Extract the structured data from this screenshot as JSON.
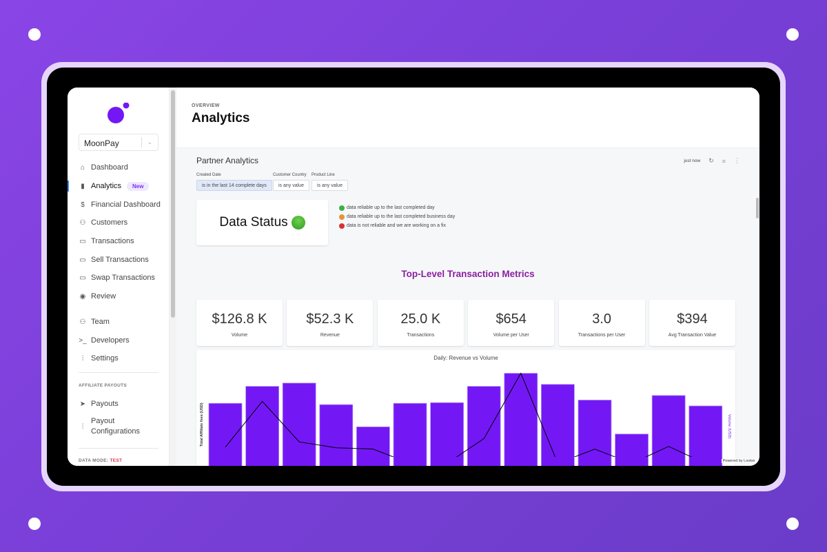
{
  "colors": {
    "accent": "#7318f5",
    "heading": "#8a1f9f",
    "test": "#e0344a",
    "line": "#000000"
  },
  "org_selector": {
    "value": "MoonPay"
  },
  "sidebar": {
    "items": [
      {
        "label": "Dashboard",
        "icon": "home-icon"
      },
      {
        "label": "Analytics",
        "icon": "bar-chart-icon",
        "badge": "New",
        "active": true
      },
      {
        "label": "Financial Dashboard",
        "icon": "dollar-icon"
      },
      {
        "label": "Customers",
        "icon": "user-check-icon"
      },
      {
        "label": "Transactions",
        "icon": "card-icon"
      },
      {
        "label": "Sell Transactions",
        "icon": "card-icon"
      },
      {
        "label": "Swap Transactions",
        "icon": "card-icon"
      },
      {
        "label": "Review",
        "icon": "eye-icon"
      },
      {
        "label": "Team",
        "icon": "users-icon"
      },
      {
        "label": "Developers",
        "icon": "terminal-icon"
      },
      {
        "label": "Settings",
        "icon": "sliders-icon"
      }
    ],
    "affiliate_section": "AFFILIATE PAYOUTS",
    "affiliate_items": [
      {
        "label": "Payouts",
        "icon": "send-icon"
      },
      {
        "label": "Payout Configurations",
        "icon": "sliders-icon"
      }
    ],
    "data_mode_label": "DATA MODE:",
    "data_mode_value": "TEST"
  },
  "header": {
    "eyebrow": "OVERVIEW",
    "title": "Analytics"
  },
  "dashboard": {
    "title": "Partner Analytics",
    "updated": "just now",
    "filters": [
      {
        "label": "Created Date",
        "value": "is in the last 14 complete days"
      },
      {
        "label": "Customer Country",
        "value": "is any value"
      },
      {
        "label": "Product Line",
        "value": "is any value"
      }
    ],
    "data_status": "Data Status",
    "legend": [
      {
        "color": "#3cb043",
        "text": "data reliable up to the last completed day"
      },
      {
        "color": "#e8923a",
        "text": "data reliable up to the last completed business day"
      },
      {
        "color": "#d93030",
        "text": "data is not reliable and we are working on a fix"
      }
    ],
    "section_title": "Top-Level Transaction Metrics",
    "kpis": [
      {
        "value": "$126.8 K",
        "label": "Volume"
      },
      {
        "value": "$52.3 K",
        "label": "Revenue"
      },
      {
        "value": "25.0 K",
        "label": "Transactions"
      },
      {
        "value": "$654",
        "label": "Volume per User"
      },
      {
        "value": "3.0",
        "label": "Transactions per User"
      },
      {
        "value": "$394",
        "label": "Avg Transaction Value"
      }
    ],
    "powered_by": "Powered by Looker"
  },
  "chart_data": {
    "type": "bar",
    "title": "Daily: Revenue vs Volume",
    "ylabel": "Total Affiliate fees (USD)",
    "y2label": "Volume (USD)",
    "series": [
      {
        "name": "Volume (USD)",
        "type": "bar",
        "values": [
          82,
          108,
          113,
          80,
          46,
          82,
          83,
          108,
          128,
          111,
          87,
          35,
          94,
          78
        ]
      },
      {
        "name": "Total Affiliate fees (USD)",
        "type": "line",
        "values": [
          15,
          85,
          23,
          14,
          12,
          -10,
          -10,
          28,
          128,
          -10,
          12,
          -10,
          16,
          -10
        ]
      }
    ],
    "ylim": [
      0,
      135
    ],
    "grid": false
  }
}
